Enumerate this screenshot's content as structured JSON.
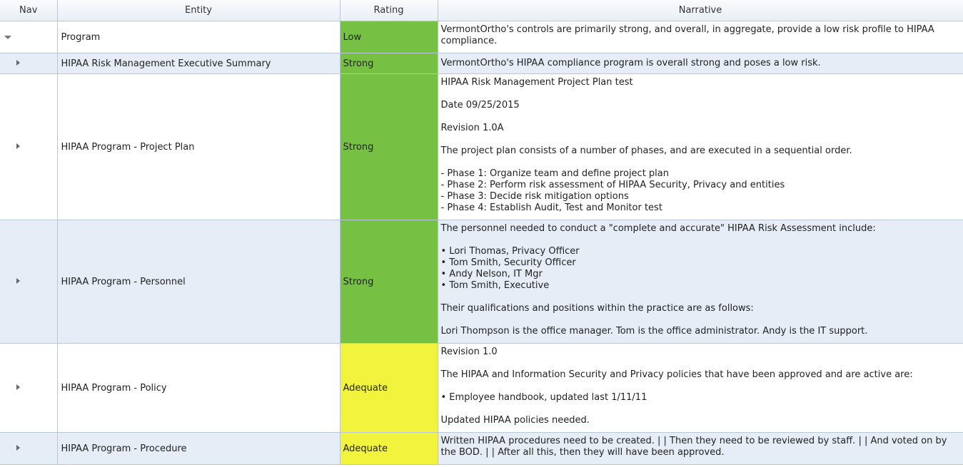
{
  "columns": {
    "nav": "Nav",
    "entity": "Entity",
    "rating": "Rating",
    "narrative": "Narrative"
  },
  "colors": {
    "strong": "#76c043",
    "adequate": "#f1f33c",
    "alt_row": "#e6edf7",
    "grid": "#b8c6d6"
  },
  "rows": [
    {
      "nav_icon": "expanded-caret-icon",
      "entity": "Program",
      "rating": "Low",
      "narrative": [
        "VermontOrtho's controls are primarily strong, and overall, in aggregate, provide a low risk profile to HIPAA compliance."
      ]
    },
    {
      "nav_icon": "collapsed-caret-icon",
      "entity": "HIPAA Risk Management Executive Summary",
      "rating": "Strong",
      "narrative": [
        "VermontOrtho's HIPAA compliance program is overall strong and poses a low risk."
      ]
    },
    {
      "nav_icon": "collapsed-caret-icon",
      "entity": "HIPAA Program - Project Plan",
      "rating": "Strong",
      "narrative": [
        "HIPAA Risk Management Project Plan test",
        "",
        "Date 09/25/2015",
        "",
        "Revision 1.0A",
        "",
        "The project plan consists of a number of phases, and are executed in a sequential order.",
        "",
        "- Phase 1: Organize team and define project plan",
        "- Phase 2: Perform risk assessment of HIPAA Security, Privacy and entities",
        "- Phase 3: Decide risk mitigation options",
        "- Phase 4: Establish Audit, Test and Monitor test"
      ]
    },
    {
      "nav_icon": "collapsed-caret-icon",
      "entity": "HIPAA Program - Personnel",
      "rating": "Strong",
      "narrative": [
        "The personnel needed to conduct a \"complete and accurate\" HIPAA Risk Assessment include:",
        "",
        "• Lori Thomas, Privacy Officer",
        "• Tom Smith, Security Officer",
        "• Andy Nelson, IT Mgr",
        "• Tom Smith, Executive",
        "",
        "Their qualifications and positions within the practice are as follows:",
        "",
        "Lori Thompson is the office manager. Tom is the office administrator. Andy is the IT support."
      ]
    },
    {
      "nav_icon": "collapsed-caret-icon",
      "entity": "HIPAA Program - Policy",
      "rating": "Adequate",
      "narrative": [
        "Revision 1.0",
        "",
        "The HIPAA and Information Security and Privacy policies that have been approved and are active are:",
        "",
        "• Employee handbook, updated last 1/11/11",
        "",
        "Updated HIPAA policies needed."
      ]
    },
    {
      "nav_icon": "collapsed-caret-icon",
      "entity": "HIPAA Program - Procedure",
      "rating": "Adequate",
      "narrative": [
        "Written HIPAA procedures need to be created. | | Then they need to be reviewed by staff. | | And voted on by the BOD. | | After all this, then they will have been approved."
      ]
    }
  ]
}
